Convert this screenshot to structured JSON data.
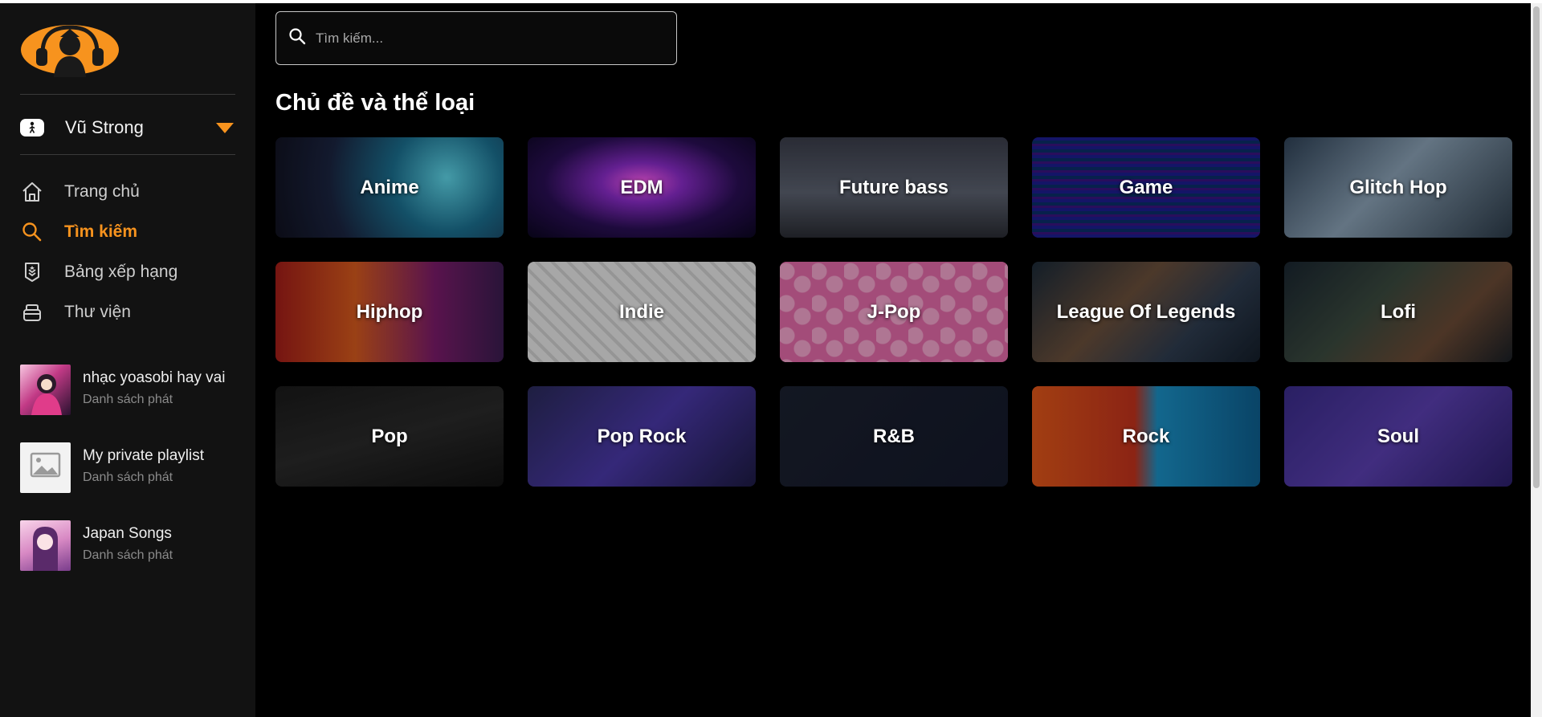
{
  "sidebar": {
    "user": {
      "name": "Vũ Strong"
    },
    "nav": [
      {
        "label": "Trang chủ",
        "icon": "home-icon",
        "active": false
      },
      {
        "label": "Tìm kiếm",
        "icon": "search-icon",
        "active": true
      },
      {
        "label": "Bảng xếp hạng",
        "icon": "badge-icon",
        "active": false
      },
      {
        "label": "Thư viện",
        "icon": "library-icon",
        "active": false
      }
    ],
    "playlists": [
      {
        "title": "nhạc yoasobi hay vai",
        "subtitle": "Danh sách phát"
      },
      {
        "title": "My private playlist",
        "subtitle": "Danh sách phát"
      },
      {
        "title": "Japan Songs",
        "subtitle": "Danh sách phát"
      }
    ]
  },
  "search": {
    "placeholder": "Tìm kiếm..."
  },
  "section": {
    "title": "Chủ đề và thể loại"
  },
  "genres": [
    {
      "label": "Anime"
    },
    {
      "label": "EDM"
    },
    {
      "label": "Future bass"
    },
    {
      "label": "Game"
    },
    {
      "label": "Glitch Hop"
    },
    {
      "label": "Hiphop"
    },
    {
      "label": "Indie"
    },
    {
      "label": "J-Pop"
    },
    {
      "label": "League Of Legends"
    },
    {
      "label": "Lofi"
    },
    {
      "label": "Pop"
    },
    {
      "label": "Pop Rock"
    },
    {
      "label": "R&B"
    },
    {
      "label": "Rock"
    },
    {
      "label": "Soul"
    }
  ],
  "colors": {
    "accent": "#f7931e",
    "sidebar_bg": "#121212",
    "page_bg": "#000000"
  }
}
